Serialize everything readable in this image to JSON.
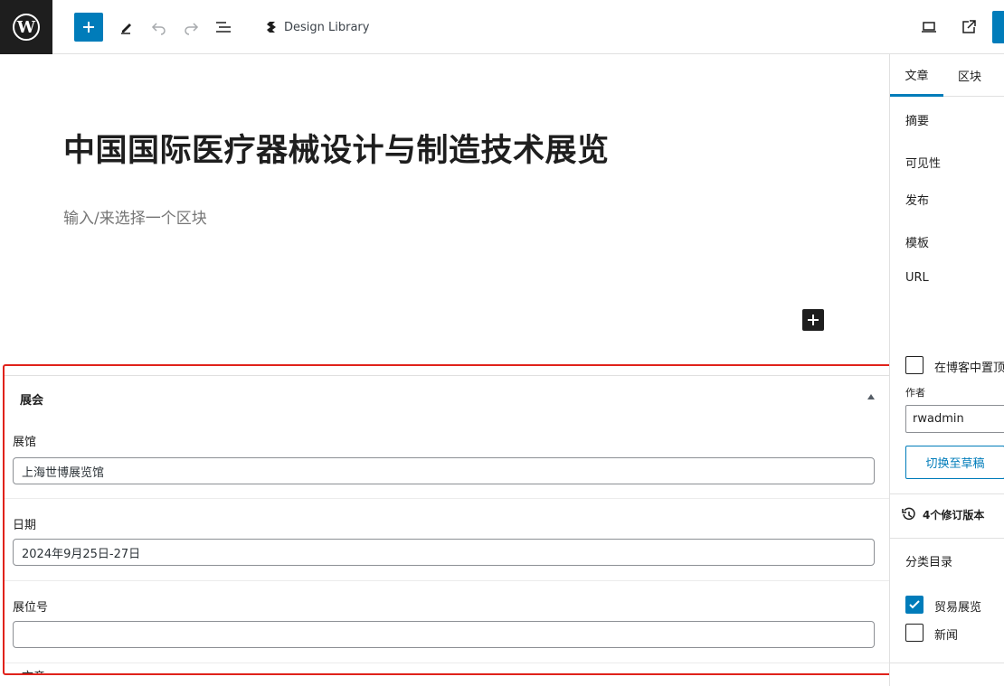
{
  "toolbar": {
    "logo_icon": "wordpress-icon",
    "add_icon": "plus-icon",
    "tools_icon": "pencil-icon",
    "undo_icon": "undo-icon",
    "redo_icon": "redo-icon",
    "list_view_icon": "list-view-icon",
    "document_title": "Design Library",
    "view_icon": "laptop-icon",
    "external_icon": "external-link-icon",
    "accent": "#007cba"
  },
  "editor": {
    "post_title": "中国国际医疗器械设计与制造技术展览",
    "block_placeholder": "输入/来选择一个区块"
  },
  "metabox": {
    "title": "展会",
    "fields": [
      {
        "label": "展馆",
        "value": "上海世博展览馆"
      },
      {
        "label": "日期",
        "value": "2024年9月25日-27日"
      },
      {
        "label": "展位号",
        "value": ""
      }
    ],
    "next_label": "文章"
  },
  "sidebar": {
    "tabs": [
      "文章",
      "区块"
    ],
    "active_tab": "文章",
    "rows": {
      "excerpt": "摘要",
      "visibility": "可见性",
      "publish": "发布",
      "template": "模板",
      "url": "URL"
    },
    "sticky_label": "在博客中置顶",
    "author_label": "作者",
    "author_value": "rwadmin",
    "switch_draft_label": "切换至草稿",
    "revisions_label": "4个修订版本",
    "categories_title": "分类目录",
    "categories": [
      {
        "name": "贸易展览",
        "checked": true
      },
      {
        "name": "新闻",
        "checked": false
      }
    ]
  }
}
